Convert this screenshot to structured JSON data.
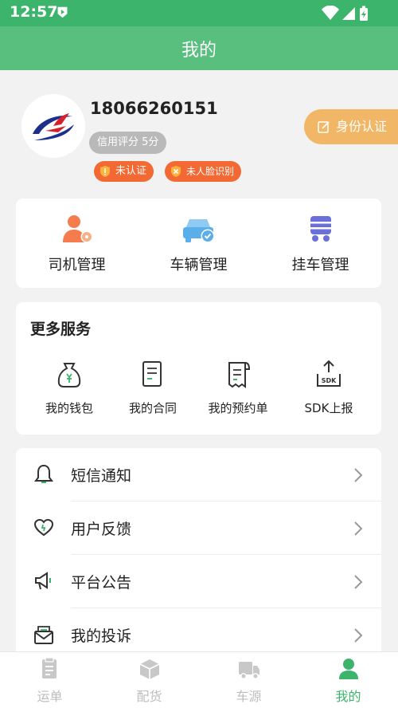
{
  "status_bar": {
    "time": "12:57"
  },
  "header": {
    "title": "我的"
  },
  "profile": {
    "phone": "18066260151",
    "credit_label": "信用评分 5分",
    "badges": {
      "unverified": "未认证",
      "no_face": "未人脸识别"
    },
    "verify_button": "身份认证"
  },
  "management": {
    "items": [
      {
        "label": "司机管理",
        "icon": "driver-icon"
      },
      {
        "label": "车辆管理",
        "icon": "vehicle-icon"
      },
      {
        "label": "挂车管理",
        "icon": "trailer-icon"
      }
    ]
  },
  "services": {
    "title": "更多服务",
    "items": [
      {
        "label": "我的钱包",
        "icon": "wallet-icon"
      },
      {
        "label": "我的合同",
        "icon": "contract-icon"
      },
      {
        "label": "我的预约单",
        "icon": "receipt-icon"
      },
      {
        "label": "SDK上报",
        "icon": "sdk-upload-icon"
      }
    ]
  },
  "menu": {
    "items": [
      {
        "label": "短信通知",
        "icon": "bell-icon"
      },
      {
        "label": "用户反馈",
        "icon": "heart-icon"
      },
      {
        "label": "平台公告",
        "icon": "megaphone-icon"
      },
      {
        "label": "我的投诉",
        "icon": "mail-icon"
      }
    ]
  },
  "tabs": {
    "items": [
      {
        "label": "运单",
        "icon": "waybill-icon",
        "active": false
      },
      {
        "label": "配货",
        "icon": "box-icon",
        "active": false
      },
      {
        "label": "车源",
        "icon": "truck-icon",
        "active": false
      },
      {
        "label": "我的",
        "icon": "user-icon",
        "active": true
      }
    ]
  },
  "colors": {
    "primary": "#3db46b",
    "header": "#58bf7f",
    "warning": "#f26934",
    "verify": "#f2b766",
    "icon_orange": "#f57c4c",
    "icon_blue": "#5aaee9",
    "icon_purple": "#6b6fd9"
  }
}
